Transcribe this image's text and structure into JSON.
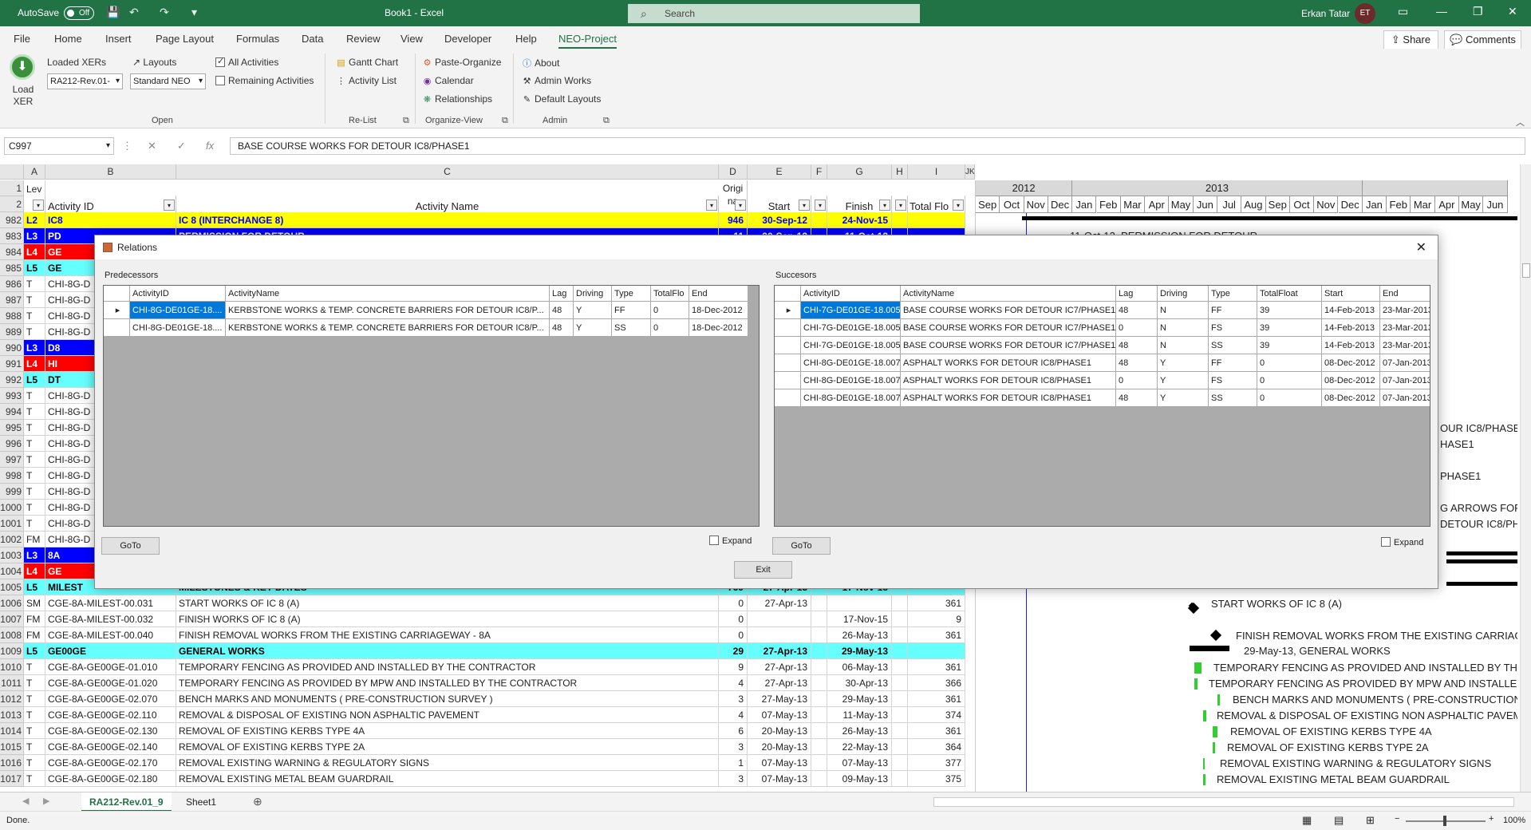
{
  "titlebar": {
    "autosave": "AutoSave",
    "toggle": "Off",
    "doc_title": "Book1  -  Excel",
    "search_placeholder": "Search",
    "user": "Erkan Tatar",
    "initials": "ET"
  },
  "menu": [
    "File",
    "Home",
    "Insert",
    "Page Layout",
    "Formulas",
    "Data",
    "Review",
    "View",
    "Developer",
    "Help",
    "NEO-Project"
  ],
  "share": "Share",
  "comments": "Comments",
  "ribbon": {
    "load_xer": "Load XER",
    "loaded_xers": "Loaded XERs",
    "xer_value": "RA212-Rev.01-",
    "layouts": "Layouts",
    "layout_value": "Standard NEO",
    "all_activities": "All Activities",
    "remaining_activities": "Remaining Activities",
    "gantt_chart": "Gantt Chart",
    "activity_list": "Activity List",
    "paste_organize": "Paste-Organize",
    "calendar": "Calendar",
    "relationships": "Relationships",
    "about": "About",
    "admin_works": "Admin Works",
    "default_layouts": "Default Layouts",
    "groups": [
      "Open",
      "Re-List",
      "Organize-View",
      "Admin"
    ]
  },
  "formula_bar": {
    "cell_ref": "C997",
    "formula": "BASE COURSE WORKS FOR DETOUR IC8/PHASE1"
  },
  "columns": [
    "A",
    "B",
    "C",
    "D",
    "E",
    "F",
    "G",
    "H",
    "I",
    "JK"
  ],
  "header_row": {
    "lev": "Lev",
    "activity_id": "Activity ID",
    "activity_name": "Activity Name",
    "orig": "Origi\nna",
    "start": "Start",
    "finish": "Finish",
    "total_float": "Total Flo"
  },
  "rows": [
    {
      "n": "982",
      "a": "L2",
      "b": "IC8",
      "c": "IC 8 (INTERCHANGE 8)",
      "d": "946",
      "e": "30-Sep-12",
      "g": "24-Nov-15",
      "i": "",
      "style": "yellow"
    },
    {
      "n": "983",
      "a": "L3",
      "b": "PD",
      "c": "PERMISSION FOR DETOUR",
      "d": "11",
      "e": "30-Sep-12",
      "g": "11-Oct-12",
      "i": "",
      "style": "blue"
    },
    {
      "n": "984",
      "a": "L4",
      "b": "GE",
      "c": "",
      "d": "",
      "e": "",
      "g": "",
      "i": "",
      "style": "red"
    },
    {
      "n": "985",
      "a": "L5",
      "b": "GE",
      "c": "",
      "d": "",
      "e": "",
      "g": "",
      "i": "",
      "style": "cyan"
    },
    {
      "n": "986",
      "a": "T",
      "b": "CHI-8G-D",
      "c": "",
      "d": "",
      "e": "",
      "g": "",
      "i": "",
      "style": ""
    },
    {
      "n": "987",
      "a": "T",
      "b": "CHI-8G-D",
      "c": "",
      "d": "",
      "e": "",
      "g": "",
      "i": "",
      "style": ""
    },
    {
      "n": "988",
      "a": "T",
      "b": "CHI-8G-D",
      "c": "",
      "d": "",
      "e": "",
      "g": "",
      "i": "",
      "style": ""
    },
    {
      "n": "989",
      "a": "T",
      "b": "CHI-8G-D",
      "c": "",
      "d": "",
      "e": "",
      "g": "",
      "i": "",
      "style": ""
    },
    {
      "n": "990",
      "a": "L3",
      "b": "D8",
      "c": "",
      "d": "",
      "e": "",
      "g": "",
      "i": "",
      "style": "blue"
    },
    {
      "n": "991",
      "a": "L4",
      "b": "HI",
      "c": "",
      "d": "",
      "e": "",
      "g": "",
      "i": "",
      "style": "red"
    },
    {
      "n": "992",
      "a": "L5",
      "b": "DT",
      "c": "",
      "d": "",
      "e": "",
      "g": "",
      "i": "",
      "style": "cyan"
    },
    {
      "n": "993",
      "a": "T",
      "b": "CHI-8G-D",
      "c": "",
      "d": "",
      "e": "",
      "g": "",
      "i": "",
      "style": ""
    },
    {
      "n": "994",
      "a": "T",
      "b": "CHI-8G-D",
      "c": "",
      "d": "",
      "e": "",
      "g": "",
      "i": "",
      "style": ""
    },
    {
      "n": "995",
      "a": "T",
      "b": "CHI-8G-D",
      "c": "",
      "d": "",
      "e": "",
      "g": "",
      "i": "",
      "style": ""
    },
    {
      "n": "996",
      "a": "T",
      "b": "CHI-8G-D",
      "c": "",
      "d": "",
      "e": "",
      "g": "",
      "i": "",
      "style": ""
    },
    {
      "n": "997",
      "a": "T",
      "b": "CHI-8G-D",
      "c": "",
      "d": "",
      "e": "",
      "g": "",
      "i": "",
      "style": ""
    },
    {
      "n": "998",
      "a": "T",
      "b": "CHI-8G-D",
      "c": "",
      "d": "",
      "e": "",
      "g": "",
      "i": "",
      "style": ""
    },
    {
      "n": "999",
      "a": "T",
      "b": "CHI-8G-D",
      "c": "",
      "d": "",
      "e": "",
      "g": "",
      "i": "",
      "style": ""
    },
    {
      "n": "1000",
      "a": "T",
      "b": "CHI-8G-D",
      "c": "",
      "d": "",
      "e": "",
      "g": "",
      "i": "",
      "style": ""
    },
    {
      "n": "1001",
      "a": "T",
      "b": "CHI-8G-D",
      "c": "",
      "d": "",
      "e": "",
      "g": "",
      "i": "",
      "style": ""
    },
    {
      "n": "1002",
      "a": "FM",
      "b": "CHI-8G-D",
      "c": "",
      "d": "",
      "e": "",
      "g": "",
      "i": "",
      "style": ""
    },
    {
      "n": "1003",
      "a": "L3",
      "b": "8A",
      "c": "",
      "d": "",
      "e": "",
      "g": "",
      "i": "",
      "style": "blue"
    },
    {
      "n": "1004",
      "a": "L4",
      "b": "GE",
      "c": "",
      "d": "",
      "e": "",
      "g": "",
      "i": "",
      "style": "red"
    },
    {
      "n": "1005",
      "a": "L5",
      "b": "MILEST",
      "c": "MILESTONES & KEY DATES",
      "d": "769",
      "e": "27-Apr-13",
      "g": "17-Nov-15",
      "i": "",
      "style": "cyan"
    },
    {
      "n": "1006",
      "a": "SM",
      "b": "CGE-8A-MILEST-00.031",
      "c": "START WORKS OF IC 8 (A)",
      "d": "0",
      "e": "27-Apr-13",
      "g": "",
      "i": "361",
      "style": ""
    },
    {
      "n": "1007",
      "a": "FM",
      "b": "CGE-8A-MILEST-00.032",
      "c": "FINISH WORKS OF IC 8 (A)",
      "d": "0",
      "e": "",
      "g": "17-Nov-15",
      "i": "9",
      "style": ""
    },
    {
      "n": "1008",
      "a": "FM",
      "b": "CGE-8A-MILEST-00.040",
      "c": "FINISH REMOVAL WORKS FROM THE EXISTING CARRIAGEWAY - 8A",
      "d": "0",
      "e": "",
      "g": "26-May-13",
      "i": "361",
      "style": ""
    },
    {
      "n": "1009",
      "a": "L5",
      "b": "GE00GE",
      "c": "GENERAL WORKS",
      "d": "29",
      "e": "27-Apr-13",
      "g": "29-May-13",
      "i": "",
      "style": "cyan"
    },
    {
      "n": "1010",
      "a": "T",
      "b": "CGE-8A-GE00GE-01.010",
      "c": "TEMPORARY FENCING AS PROVIDED AND INSTALLED BY THE CONTRACTOR",
      "d": "9",
      "e": "27-Apr-13",
      "g": "06-May-13",
      "i": "361",
      "style": ""
    },
    {
      "n": "1011",
      "a": "T",
      "b": "CGE-8A-GE00GE-01.020",
      "c": "TEMPORARY FENCING AS PROVIDED BY MPW AND INSTALLED BY THE CONTRACTOR",
      "d": "4",
      "e": "27-Apr-13",
      "g": "30-Apr-13",
      "i": "366",
      "style": ""
    },
    {
      "n": "1012",
      "a": "T",
      "b": "CGE-8A-GE00GE-02.070",
      "c": "BENCH MARKS AND MONUMENTS ( PRE-CONSTRUCTION SURVEY )",
      "d": "3",
      "e": "27-May-13",
      "g": "29-May-13",
      "i": "361",
      "style": ""
    },
    {
      "n": "1013",
      "a": "T",
      "b": "CGE-8A-GE00GE-02.110",
      "c": "REMOVAL & DISPOSAL OF EXISTING NON ASPHALTIC PAVEMENT",
      "d": "4",
      "e": "07-May-13",
      "g": "11-May-13",
      "i": "374",
      "style": ""
    },
    {
      "n": "1014",
      "a": "T",
      "b": "CGE-8A-GE00GE-02.130",
      "c": "REMOVAL OF EXISTING KERBS TYPE 4A",
      "d": "6",
      "e": "20-May-13",
      "g": "26-May-13",
      "i": "361",
      "style": ""
    },
    {
      "n": "1015",
      "a": "T",
      "b": "CGE-8A-GE00GE-02.140",
      "c": "REMOVAL OF EXISTING KERBS TYPE 2A",
      "d": "3",
      "e": "20-May-13",
      "g": "22-May-13",
      "i": "364",
      "style": ""
    },
    {
      "n": "1016",
      "a": "T",
      "b": "CGE-8A-GE00GE-02.170",
      "c": "REMOVAL EXISTING WARNING & REGULATORY SIGNS",
      "d": "1",
      "e": "07-May-13",
      "g": "07-May-13",
      "i": "377",
      "style": ""
    },
    {
      "n": "1017",
      "a": "T",
      "b": "CGE-8A-GE00GE-02.180",
      "c": "REMOVAL EXISTING METAL BEAM GUARDRAIL",
      "d": "3",
      "e": "07-May-13",
      "g": "09-May-13",
      "i": "375",
      "style": ""
    }
  ],
  "gantt": {
    "years": [
      "2012",
      "2013"
    ],
    "months": [
      "Sep",
      "Oct",
      "Nov",
      "Dec",
      "Jan",
      "Feb",
      "Mar",
      "Apr",
      "May",
      "Jun",
      "Jul",
      "Aug",
      "Sep",
      "Oct",
      "Nov",
      "Dec",
      "Jan",
      "Feb",
      "Mar",
      "Apr",
      "May",
      "Jun"
    ],
    "labels": {
      "permission": "11-Oct-12, PERMISSION FOR DETOUR",
      "frag1": "OUR IC8/PHASE1",
      "frag2": "HASE1",
      "frag3": "PHASE1",
      "frag4": "G ARROWS  FOR",
      "frag5": "DETOUR IC8/PHA",
      "start_works": "START WORKS OF IC 8 (A)",
      "finish_removal": "FINISH REMOVAL WORKS FROM THE EXISTING CARRIAGEW",
      "general": "29-May-13, GENERAL WORKS",
      "t1010": "TEMPORARY FENCING AS PROVIDED AND INSTALLED BY THE CO",
      "t1011": "TEMPORARY FENCING AS PROVIDED BY MPW AND INSTALLED B",
      "t1012": "BENCH MARKS AND MONUMENTS ( PRE-CONSTRUCTION SU",
      "t1013": "REMOVAL & DISPOSAL OF EXISTING NON ASPHALTIC PAVEMEN",
      "t1014": "REMOVAL OF EXISTING KERBS TYPE 4A",
      "t1015": "REMOVAL OF EXISTING KERBS TYPE 2A",
      "t1016": "REMOVAL EXISTING WARNING & REGULATORY SIGNS",
      "t1017": "REMOVAL EXISTING METAL BEAM GUARDRAIL"
    }
  },
  "dialog": {
    "title": "Relations",
    "predecessors_label": "Predecessors",
    "successors_label": "Succesors",
    "pred_headers": [
      "ActivityID",
      "ActivityName",
      "Lag",
      "Driving",
      "Type",
      "TotalFlo",
      "End"
    ],
    "pred_rows": [
      [
        "CHI-8G-DE01GE-18....",
        "KERBSTONE WORKS & TEMP. CONCRETE BARRIERS FOR DETOUR IC8/P...",
        "48",
        "Y",
        "FF",
        "0",
        "18-Dec-2012"
      ],
      [
        "CHI-8G-DE01GE-18....",
        "KERBSTONE WORKS & TEMP. CONCRETE BARRIERS FOR DETOUR IC8/P...",
        "48",
        "Y",
        "SS",
        "0",
        "18-Dec-2012"
      ]
    ],
    "succ_headers": [
      "ActivityID",
      "ActivityName",
      "Lag",
      "Driving",
      "Type",
      "TotalFloat",
      "Start",
      "End"
    ],
    "succ_rows": [
      [
        "CHI-7G-DE01GE-18.005",
        "BASE COURSE WORKS FOR DETOUR IC7/PHASE1",
        "48",
        "N",
        "FF",
        "39",
        "14-Feb-2013",
        "23-Mar-2013"
      ],
      [
        "CHI-7G-DE01GE-18.005",
        "BASE COURSE WORKS FOR DETOUR IC7/PHASE1",
        "0",
        "N",
        "FS",
        "39",
        "14-Feb-2013",
        "23-Mar-2013"
      ],
      [
        "CHI-7G-DE01GE-18.005",
        "BASE COURSE WORKS FOR DETOUR IC7/PHASE1",
        "48",
        "N",
        "SS",
        "39",
        "14-Feb-2013",
        "23-Mar-2013"
      ],
      [
        "CHI-8G-DE01GE-18.007",
        "ASPHALT WORKS FOR DETOUR IC8/PHASE1",
        "48",
        "Y",
        "FF",
        "0",
        "08-Dec-2012",
        "07-Jan-2013"
      ],
      [
        "CHI-8G-DE01GE-18.007",
        "ASPHALT WORKS FOR DETOUR IC8/PHASE1",
        "0",
        "Y",
        "FS",
        "0",
        "08-Dec-2012",
        "07-Jan-2013"
      ],
      [
        "CHI-8G-DE01GE-18.007",
        "ASPHALT WORKS FOR DETOUR IC8/PHASE1",
        "48",
        "Y",
        "SS",
        "0",
        "08-Dec-2012",
        "07-Jan-2013"
      ]
    ],
    "goto": "GoTo",
    "expand": "Expand",
    "exit": "Exit"
  },
  "sheets": [
    "RA212-Rev.01_9",
    "Sheet1"
  ],
  "status": {
    "text": "Done.",
    "zoom": "100%"
  },
  "colors": {
    "excel_green": "#217346",
    "yellow": "#ffff00",
    "blue": "#0000ff",
    "red": "#ff0000",
    "cyan": "#66ffff",
    "selection": "#0078d7",
    "gantt_bar": "#33cc33"
  }
}
